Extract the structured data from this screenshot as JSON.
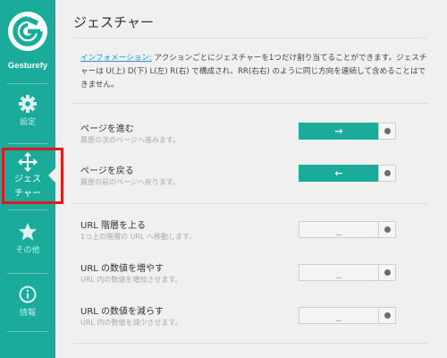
{
  "app": {
    "name": "Gesturefy"
  },
  "sidebar": {
    "items": [
      {
        "label": "設定",
        "icon": "gear-icon"
      },
      {
        "label": "ジェス\nチャー",
        "label_line1": "ジェス",
        "label_line2": "チャー",
        "icon": "move-arrows-icon",
        "active": true
      },
      {
        "label": "その他",
        "icon": "star-icon"
      },
      {
        "label": "情報",
        "icon": "info-icon"
      }
    ]
  },
  "main": {
    "title": "ジェスチャー",
    "info_link": "インフォメーション:",
    "info_text": " アクションごとにジェスチャーを1つだけ割り当てることができます。ジェスチャーは U(上) D(下) L(左) R(右) で構成され、RR(右右) のように同じ方向を連続して含めることはできません。"
  },
  "rows": [
    {
      "title": "ページを進む",
      "desc": "履歴の次のページへ進みます。",
      "gesture": "→",
      "assigned": true
    },
    {
      "title": "ページを戻る",
      "desc": "履歴の前のページへ戻ります。",
      "gesture": "←",
      "assigned": true
    },
    {
      "title": "URL 階層を上る",
      "desc": "1つ上の階層の URL へ移動します。",
      "gesture": "_",
      "assigned": false
    },
    {
      "title": "URL の数値を増やす",
      "desc": "URL 内の数値を増加させます。",
      "gesture": "_",
      "assigned": false
    },
    {
      "title": "URL の数値を減らす",
      "desc": "URL 内の数値を減少させます。",
      "gesture": "_",
      "assigned": false
    }
  ],
  "colors": {
    "accent": "#1aab9b",
    "highlight_border": "#e0191e",
    "link": "#1a9ad6"
  }
}
